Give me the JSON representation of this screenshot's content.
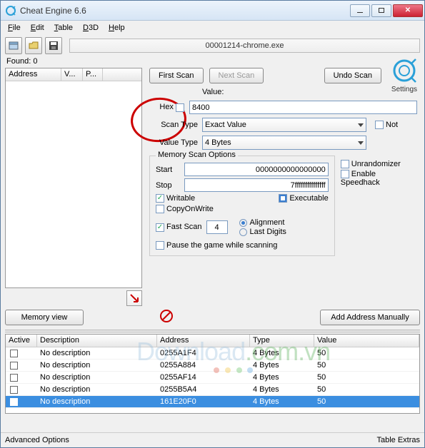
{
  "window": {
    "title": "Cheat Engine 6.6"
  },
  "menu": {
    "file": "File",
    "edit": "Edit",
    "table": "Table",
    "d3d": "D3D",
    "help": "Help"
  },
  "process": {
    "name": "00001214-chrome.exe"
  },
  "found": {
    "label": "Found:",
    "count": "0"
  },
  "addrlist": {
    "hAddress": "Address",
    "hValue": "V...",
    "hPrev": "P..."
  },
  "buttons": {
    "firstScan": "First Scan",
    "nextScan": "Next Scan",
    "undoScan": "Undo Scan",
    "memoryView": "Memory view",
    "addManual": "Add Address Manually"
  },
  "settingsLabel": "Settings",
  "valueLabel": "Value:",
  "hexLabel": "Hex",
  "valueInput": "8400",
  "scanTypeLabel": "Scan Type",
  "scanTypeValue": "Exact Value",
  "notLabel": "Not",
  "valueTypeLabel": "Value Type",
  "valueTypeValue": "4 Bytes",
  "mso": {
    "title": "Memory Scan Options",
    "startLabel": "Start",
    "startValue": "0000000000000000",
    "stopLabel": "Stop",
    "stopValue": "7fffffffffffffff",
    "writable": "Writable",
    "executable": "Executable",
    "copyOnWrite": "CopyOnWrite",
    "fastScan": "Fast Scan",
    "fastScanValue": "4",
    "alignment": "Alignment",
    "lastDigits": "Last Digits",
    "pause": "Pause the game while scanning"
  },
  "sideOpts": {
    "unrandomizer": "Unrandomizer",
    "speedhack": "Enable Speedhack"
  },
  "table": {
    "headers": {
      "active": "Active",
      "description": "Description",
      "address": "Address",
      "type": "Type",
      "value": "Value"
    },
    "rows": [
      {
        "desc": "No description",
        "addr": "0255A1F4",
        "type": "4 Bytes",
        "val": "50",
        "selected": false
      },
      {
        "desc": "No description",
        "addr": "0255A884",
        "type": "4 Bytes",
        "val": "50",
        "selected": false
      },
      {
        "desc": "No description",
        "addr": "0255AF14",
        "type": "4 Bytes",
        "val": "50",
        "selected": false
      },
      {
        "desc": "No description",
        "addr": "0255B5A4",
        "type": "4 Bytes",
        "val": "50",
        "selected": false
      },
      {
        "desc": "No description",
        "addr": "161E20F0",
        "type": "4 Bytes",
        "val": "50",
        "selected": true
      }
    ]
  },
  "footer": {
    "advOpts": "Advanced Options",
    "tableExtras": "Table Extras"
  },
  "watermark": "Download"
}
